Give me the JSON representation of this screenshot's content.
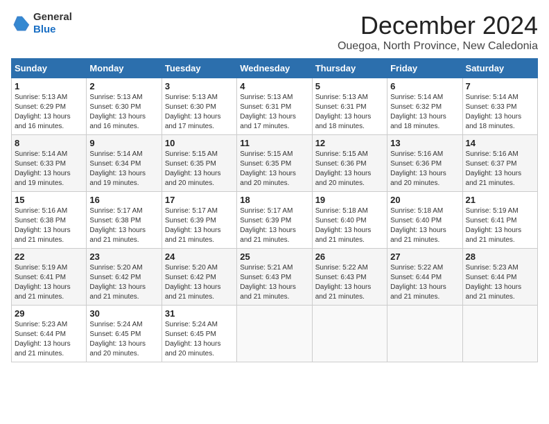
{
  "header": {
    "logo_general": "General",
    "logo_blue": "Blue",
    "main_title": "December 2024",
    "subtitle": "Ouegoa, North Province, New Caledonia"
  },
  "calendar": {
    "headers": [
      "Sunday",
      "Monday",
      "Tuesday",
      "Wednesday",
      "Thursday",
      "Friday",
      "Saturday"
    ],
    "weeks": [
      [
        {
          "day": "1",
          "sunrise": "5:13 AM",
          "sunset": "6:29 PM",
          "daylight": "13 hours and 16 minutes."
        },
        {
          "day": "2",
          "sunrise": "5:13 AM",
          "sunset": "6:30 PM",
          "daylight": "13 hours and 16 minutes."
        },
        {
          "day": "3",
          "sunrise": "5:13 AM",
          "sunset": "6:30 PM",
          "daylight": "13 hours and 17 minutes."
        },
        {
          "day": "4",
          "sunrise": "5:13 AM",
          "sunset": "6:31 PM",
          "daylight": "13 hours and 17 minutes."
        },
        {
          "day": "5",
          "sunrise": "5:13 AM",
          "sunset": "6:31 PM",
          "daylight": "13 hours and 18 minutes."
        },
        {
          "day": "6",
          "sunrise": "5:14 AM",
          "sunset": "6:32 PM",
          "daylight": "13 hours and 18 minutes."
        },
        {
          "day": "7",
          "sunrise": "5:14 AM",
          "sunset": "6:33 PM",
          "daylight": "13 hours and 18 minutes."
        }
      ],
      [
        {
          "day": "8",
          "sunrise": "5:14 AM",
          "sunset": "6:33 PM",
          "daylight": "13 hours and 19 minutes."
        },
        {
          "day": "9",
          "sunrise": "5:14 AM",
          "sunset": "6:34 PM",
          "daylight": "13 hours and 19 minutes."
        },
        {
          "day": "10",
          "sunrise": "5:15 AM",
          "sunset": "6:35 PM",
          "daylight": "13 hours and 20 minutes."
        },
        {
          "day": "11",
          "sunrise": "5:15 AM",
          "sunset": "6:35 PM",
          "daylight": "13 hours and 20 minutes."
        },
        {
          "day": "12",
          "sunrise": "5:15 AM",
          "sunset": "6:36 PM",
          "daylight": "13 hours and 20 minutes."
        },
        {
          "day": "13",
          "sunrise": "5:16 AM",
          "sunset": "6:36 PM",
          "daylight": "13 hours and 20 minutes."
        },
        {
          "day": "14",
          "sunrise": "5:16 AM",
          "sunset": "6:37 PM",
          "daylight": "13 hours and 21 minutes."
        }
      ],
      [
        {
          "day": "15",
          "sunrise": "5:16 AM",
          "sunset": "6:38 PM",
          "daylight": "13 hours and 21 minutes."
        },
        {
          "day": "16",
          "sunrise": "5:17 AM",
          "sunset": "6:38 PM",
          "daylight": "13 hours and 21 minutes."
        },
        {
          "day": "17",
          "sunrise": "5:17 AM",
          "sunset": "6:39 PM",
          "daylight": "13 hours and 21 minutes."
        },
        {
          "day": "18",
          "sunrise": "5:17 AM",
          "sunset": "6:39 PM",
          "daylight": "13 hours and 21 minutes."
        },
        {
          "day": "19",
          "sunrise": "5:18 AM",
          "sunset": "6:40 PM",
          "daylight": "13 hours and 21 minutes."
        },
        {
          "day": "20",
          "sunrise": "5:18 AM",
          "sunset": "6:40 PM",
          "daylight": "13 hours and 21 minutes."
        },
        {
          "day": "21",
          "sunrise": "5:19 AM",
          "sunset": "6:41 PM",
          "daylight": "13 hours and 21 minutes."
        }
      ],
      [
        {
          "day": "22",
          "sunrise": "5:19 AM",
          "sunset": "6:41 PM",
          "daylight": "13 hours and 21 minutes."
        },
        {
          "day": "23",
          "sunrise": "5:20 AM",
          "sunset": "6:42 PM",
          "daylight": "13 hours and 21 minutes."
        },
        {
          "day": "24",
          "sunrise": "5:20 AM",
          "sunset": "6:42 PM",
          "daylight": "13 hours and 21 minutes."
        },
        {
          "day": "25",
          "sunrise": "5:21 AM",
          "sunset": "6:43 PM",
          "daylight": "13 hours and 21 minutes."
        },
        {
          "day": "26",
          "sunrise": "5:22 AM",
          "sunset": "6:43 PM",
          "daylight": "13 hours and 21 minutes."
        },
        {
          "day": "27",
          "sunrise": "5:22 AM",
          "sunset": "6:44 PM",
          "daylight": "13 hours and 21 minutes."
        },
        {
          "day": "28",
          "sunrise": "5:23 AM",
          "sunset": "6:44 PM",
          "daylight": "13 hours and 21 minutes."
        }
      ],
      [
        {
          "day": "29",
          "sunrise": "5:23 AM",
          "sunset": "6:44 PM",
          "daylight": "13 hours and 21 minutes."
        },
        {
          "day": "30",
          "sunrise": "5:24 AM",
          "sunset": "6:45 PM",
          "daylight": "13 hours and 20 minutes."
        },
        {
          "day": "31",
          "sunrise": "5:24 AM",
          "sunset": "6:45 PM",
          "daylight": "13 hours and 20 minutes."
        },
        null,
        null,
        null,
        null
      ]
    ]
  }
}
